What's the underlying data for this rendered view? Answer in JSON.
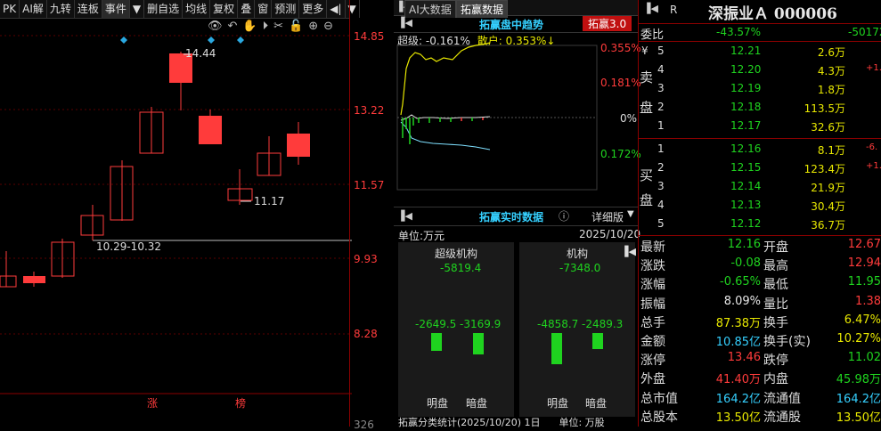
{
  "toolbar": {
    "items": [
      "PK",
      "AI解",
      "九转",
      "连板",
      "事件",
      "▼",
      "删自选",
      "均线",
      "复权",
      "叠",
      "窗",
      "预测",
      "更多",
      "◀|",
      "▼"
    ]
  },
  "candle_chart": {
    "price_axis": [
      "14.85",
      "13.22",
      "11.57",
      "9.93",
      "8.28",
      "326"
    ],
    "high_label": "14.44",
    "low_label": "11.17",
    "range_label": "10.29-10.32",
    "markers": [
      "涨",
      "榜"
    ]
  },
  "tabs": [
    "AI大数据",
    "拓赢数据"
  ],
  "intraday": {
    "title": "拓赢盘中趋势",
    "badge": "拓赢3.0",
    "legend_super": "超级: -0.161%",
    "legend_retail": "散户: 0.353%↓",
    "right_axis": [
      "0.355%",
      "0.181%",
      "0%",
      "0.172%"
    ]
  },
  "realtime": {
    "title": "拓赢实时数据",
    "detail_label": "详细版",
    "unit": "单位:万元",
    "date": "2025/10/20",
    "super_inst": {
      "title": "超级机构",
      "total": "-5819.4",
      "open": "-2649.5",
      "dark": "-3169.9",
      "open_label": "明盘",
      "dark_label": "暗盘"
    },
    "inst": {
      "title": "机构",
      "total": "-7348.0",
      "open": "-4858.7",
      "dark": "-2489.3",
      "open_label": "明盘",
      "dark_label": "暗盘"
    },
    "footer": "拓赢分类统计(2025/10/20) 1日      单位: 万股"
  },
  "stock": {
    "badge": "R",
    "name_code": "深振业Ａ 000006",
    "weibi_label": "委比",
    "weibi": "-43.57%",
    "weicha": "-50172",
    "sell_label": [
      "卖",
      "盘"
    ],
    "buy_label": [
      "买",
      "盘"
    ],
    "sell": [
      {
        "lvl": "5",
        "price": "12.21",
        "vol": "2.6万",
        "chg": ""
      },
      {
        "lvl": "4",
        "price": "12.20",
        "vol": "4.3万",
        "chg": "+1."
      },
      {
        "lvl": "3",
        "price": "12.19",
        "vol": "1.8万",
        "chg": ""
      },
      {
        "lvl": "2",
        "price": "12.18",
        "vol": "113.5万",
        "chg": ""
      },
      {
        "lvl": "1",
        "price": "12.17",
        "vol": "32.6万",
        "chg": ""
      }
    ],
    "buy": [
      {
        "lvl": "1",
        "price": "12.16",
        "vol": "8.1万",
        "chg": "-6."
      },
      {
        "lvl": "2",
        "price": "12.15",
        "vol": "123.4万",
        "chg": "+1."
      },
      {
        "lvl": "3",
        "price": "12.14",
        "vol": "21.9万",
        "chg": ""
      },
      {
        "lvl": "4",
        "price": "12.13",
        "vol": "30.4万",
        "chg": ""
      },
      {
        "lvl": "5",
        "price": "12.12",
        "vol": "36.7万",
        "chg": ""
      }
    ],
    "stats": [
      {
        "l1": "最新",
        "v1": "12.16",
        "c1": "green",
        "l2": "开盘",
        "v2": "12.67",
        "c2": "red"
      },
      {
        "l1": "涨跌",
        "v1": "-0.08",
        "c1": "green",
        "l2": "最高",
        "v2": "12.94",
        "c2": "red"
      },
      {
        "l1": "涨幅",
        "v1": "-0.65%",
        "c1": "green",
        "l2": "最低",
        "v2": "11.95",
        "c2": "green"
      },
      {
        "l1": "振幅",
        "v1": "8.09%",
        "c1": "white",
        "l2": "量比",
        "v2": "1.38",
        "c2": "red"
      },
      {
        "l1": "总手",
        "v1": "87.38万",
        "c1": "yellow",
        "l2": "换手",
        "v2": "6.47%",
        "c2": "yellow"
      },
      {
        "l1": "金额",
        "v1": "10.85亿",
        "c1": "cyan",
        "l2": "换手(实)",
        "v2": "10.27%",
        "c2": "yellow"
      },
      {
        "l1": "涨停",
        "v1": "13.46",
        "c1": "red",
        "l2": "跌停",
        "v2": "11.02",
        "c2": "green"
      },
      {
        "l1": "外盘",
        "v1": "41.40万",
        "c1": "red",
        "l2": "内盘",
        "v2": "45.98万",
        "c2": "green"
      },
      {
        "l1": "总市值",
        "v1": "164.2亿",
        "c1": "cyan",
        "l2": "流通值",
        "v2": "164.2亿",
        "c2": "cyan"
      },
      {
        "l1": "总股本",
        "v1": "13.50亿",
        "c1": "yellow",
        "l2": "流通股",
        "v2": "13.50亿",
        "c2": "yellow"
      }
    ]
  }
}
